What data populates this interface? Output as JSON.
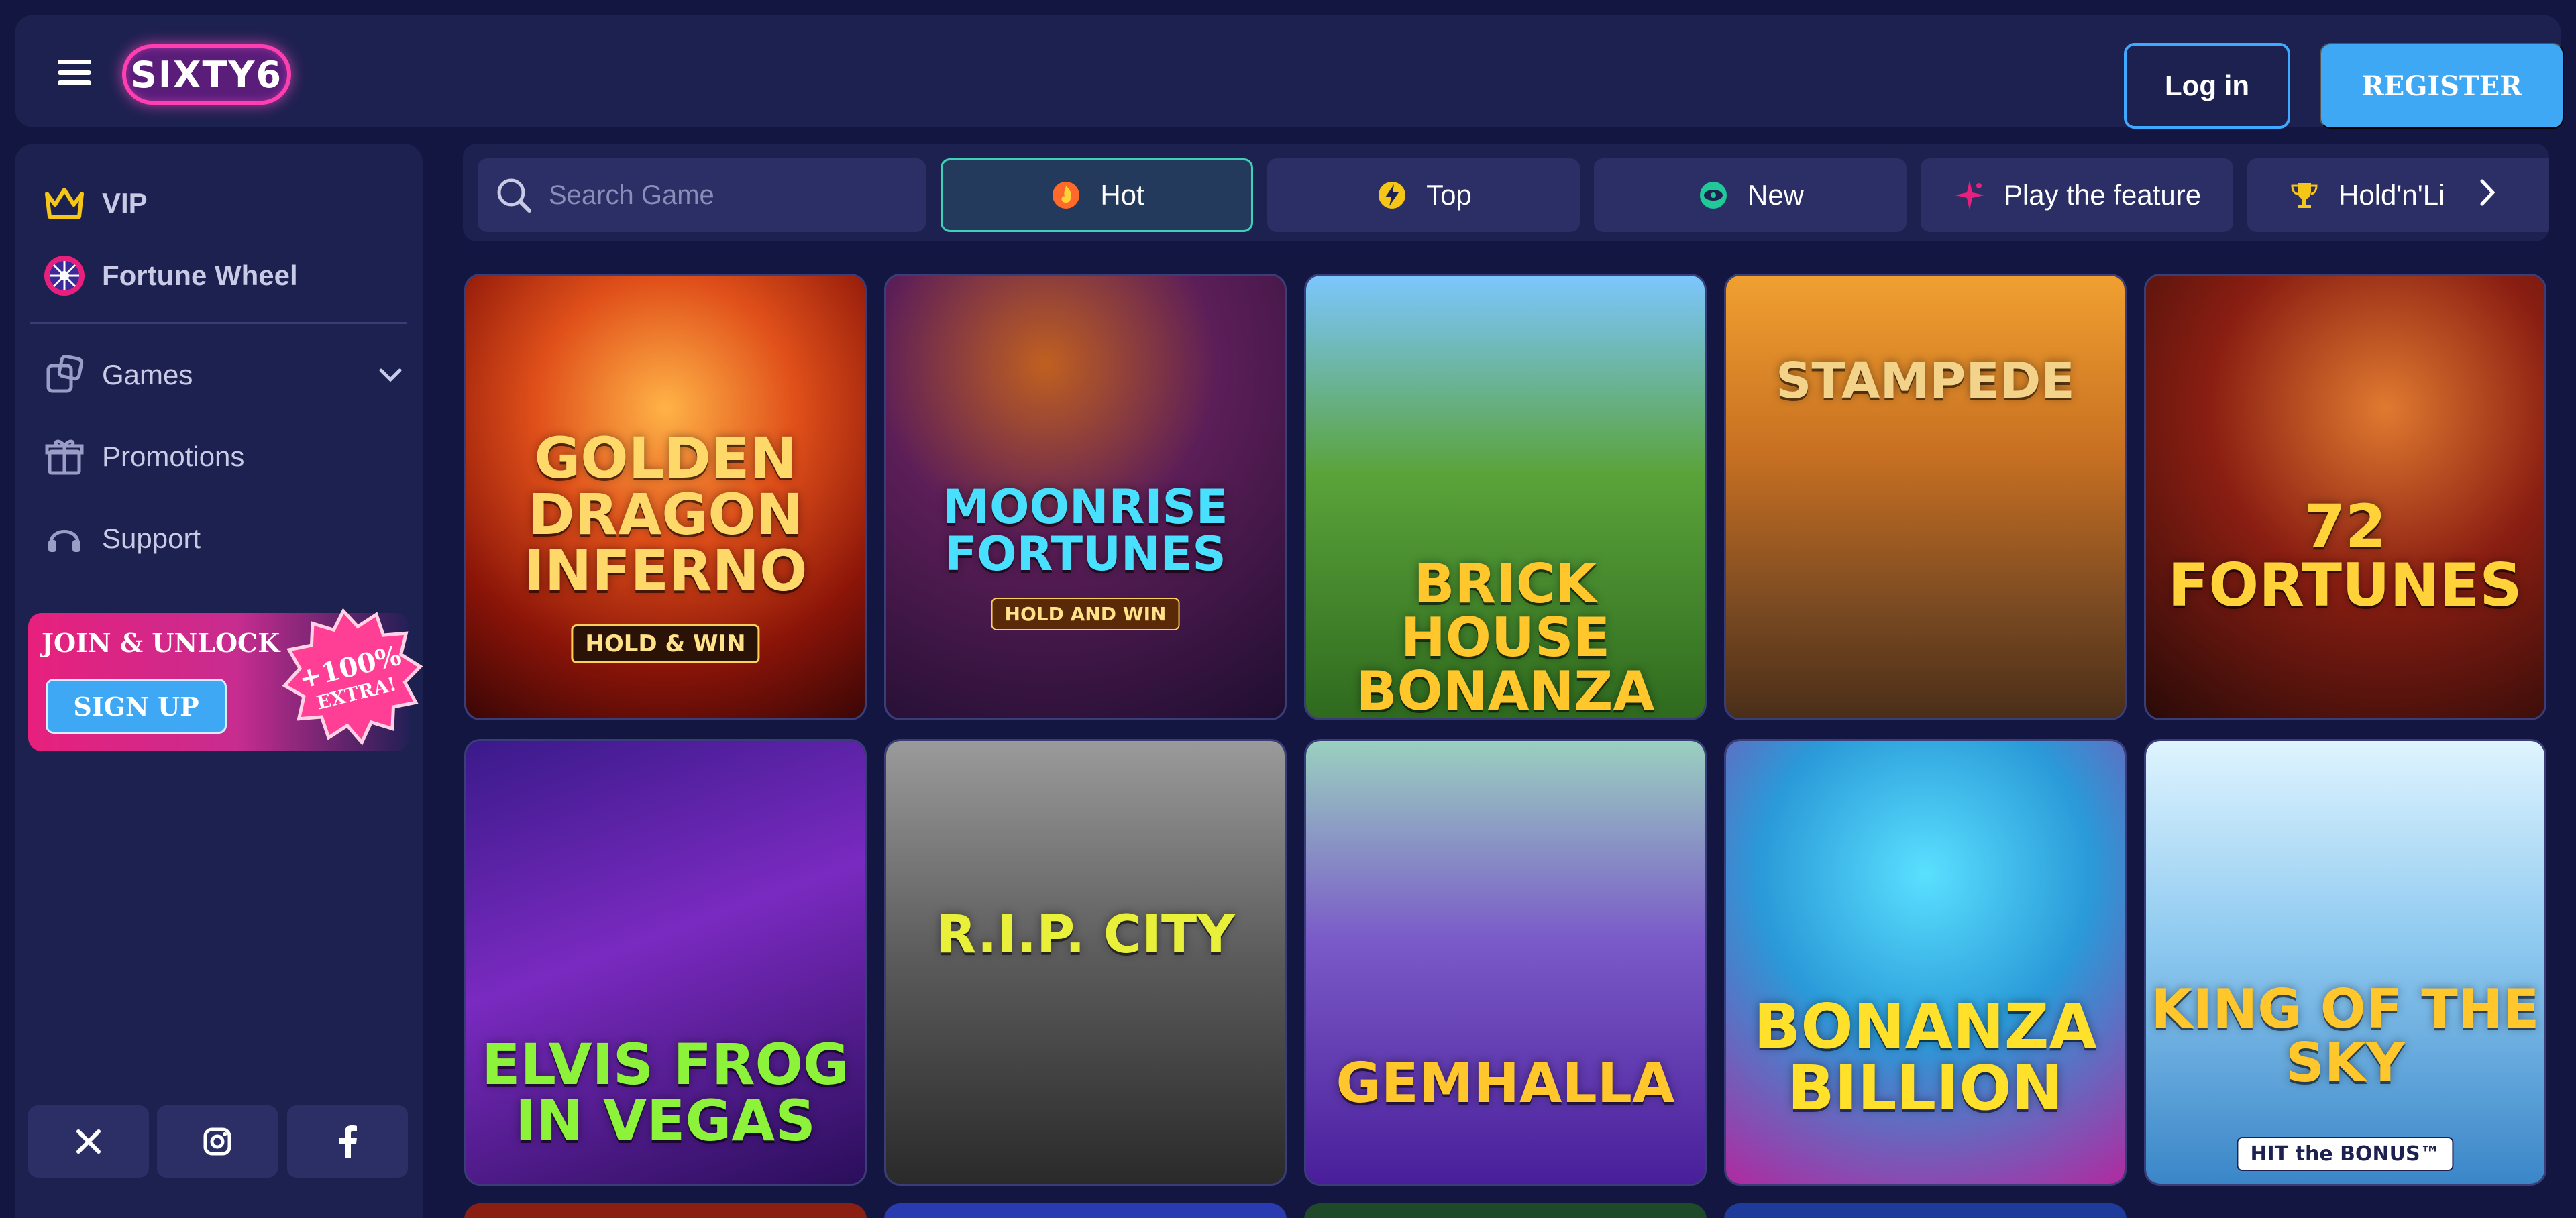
{
  "header": {
    "logo_text": "SIXTY6",
    "login_label": "Log in",
    "register_label": "REGISTER"
  },
  "sidebar": {
    "items": [
      {
        "label": "VIP",
        "icon": "crown-icon"
      },
      {
        "label": "Fortune Wheel",
        "icon": "fortune-wheel-icon"
      },
      {
        "label": "Games",
        "icon": "games-icon"
      },
      {
        "label": "Promotions",
        "icon": "gift-icon"
      },
      {
        "label": "Support",
        "icon": "headset-icon"
      }
    ],
    "promo": {
      "title": "JOIN & UNLOCK",
      "button": "SIGN UP",
      "badge_line1": "+100%",
      "badge_line2": "EXTRA!"
    },
    "socials": [
      "x-icon",
      "instagram-icon",
      "facebook-icon"
    ]
  },
  "filters": {
    "search_placeholder": "Search Game",
    "chips": [
      {
        "label": "Hot",
        "icon": "flame-icon",
        "active": true
      },
      {
        "label": "Top",
        "icon": "lightning-icon",
        "active": false
      },
      {
        "label": "New",
        "icon": "new-icon",
        "active": false
      },
      {
        "label": "Play the feature",
        "icon": "sparkle-icon",
        "active": false
      },
      {
        "label": "Hold'n'Li",
        "icon": "trophy-icon",
        "active": false
      }
    ]
  },
  "games": [
    {
      "title": "GOLDEN DRAGON INFERNO",
      "subtitle": "HOLD & WIN"
    },
    {
      "title": "MOONRISE FORTUNES",
      "subtitle": "HOLD AND WIN"
    },
    {
      "title": "BRICK HOUSE BONANZA",
      "subtitle": ""
    },
    {
      "title": "STAMPEDE",
      "subtitle": ""
    },
    {
      "title": "72 FORTUNES",
      "subtitle": ""
    },
    {
      "title": "ELVIS FROG IN VEGAS",
      "subtitle": ""
    },
    {
      "title": "R.I.P. CITY",
      "subtitle": ""
    },
    {
      "title": "GEMHALLA",
      "subtitle": ""
    },
    {
      "title": "BONANZA BILLION",
      "subtitle": ""
    },
    {
      "title": "KING OF THE SKY",
      "subtitle": "HIT the BONUS™"
    }
  ],
  "colors": {
    "background": "#131640",
    "panel": "#1d2150",
    "accent_blue": "#3fa8f5",
    "accent_pink": "#e8207d",
    "active_chip_border": "#3ed0b8"
  }
}
